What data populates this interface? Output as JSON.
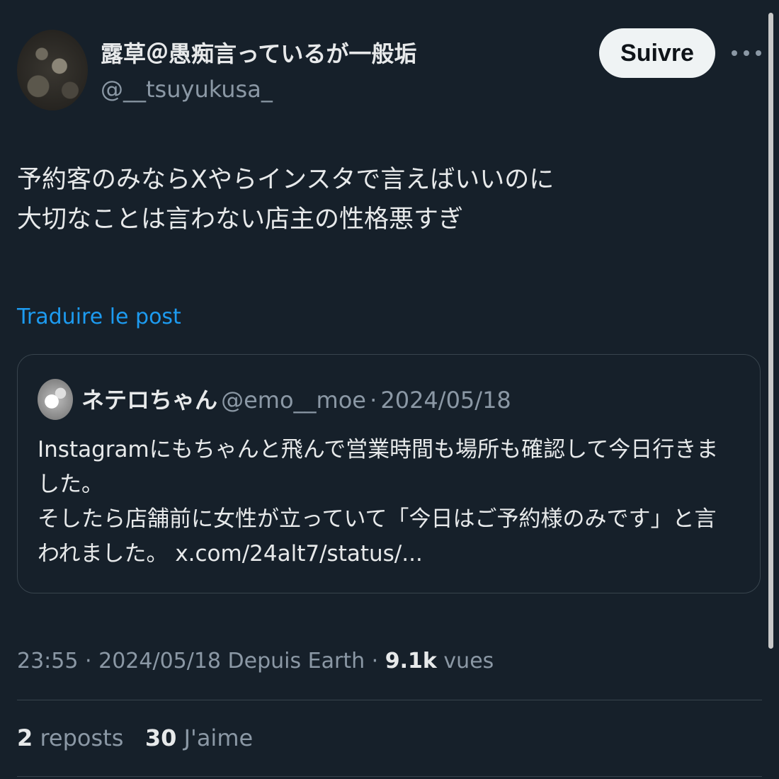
{
  "author": {
    "display_name": "露草＠愚痴言っているが一般垢",
    "handle": "@__tsuyukusa_"
  },
  "actions": {
    "follow_label": "Suivre",
    "more_icon": "ellipsis-icon"
  },
  "post": {
    "lines": [
      "予約客のみならXやらインスタで言えばいいのに",
      "大切なことは言わない店主の性格悪すぎ"
    ],
    "translate_label": "Traduire le post"
  },
  "quote": {
    "name": "ネテロちゃん",
    "handle": "@emo__moe",
    "separator": "·",
    "date": "2024/05/18",
    "lines": [
      "Instagramにもちゃんと飛んで営業時間も場所も確認して今日行きま",
      "した。",
      "そしたら店舗前に女性が立っていて「今日はご予約様のみです」と言",
      "われました。"
    ],
    "link": "x.com/24alt7/status/..."
  },
  "meta": {
    "time": "23:55",
    "separator": "·",
    "date_source": "2024/05/18 Depuis Earth",
    "views_count": "9.1k",
    "views_label": "vues"
  },
  "stats": {
    "reposts_count": "2",
    "reposts_label": "reposts",
    "likes_count": "30",
    "likes_label": "J'aime"
  },
  "colors": {
    "background": "#16202a",
    "accent": "#1d9bf0",
    "text": "#e7e9ea",
    "muted": "#8b98a5",
    "border": "#38444d"
  }
}
